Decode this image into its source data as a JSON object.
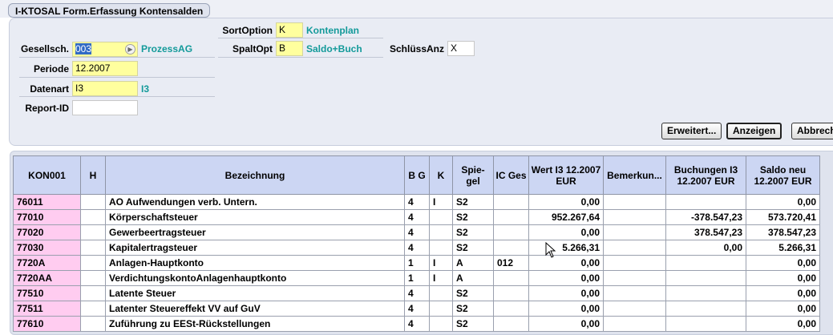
{
  "window": {
    "title": "I-KTOSAL Form.Erfassung Kontensalden"
  },
  "form": {
    "gesellsch": {
      "label": "Gesellsch.",
      "value": "003",
      "desc": "ProzessAG"
    },
    "periode": {
      "label": "Periode",
      "value": "12.2007"
    },
    "datenart": {
      "label": "Datenart",
      "value": "I3",
      "desc": "I3"
    },
    "report_id": {
      "label": "Report-ID",
      "value": ""
    },
    "sortoption": {
      "label": "SortOption",
      "value": "K",
      "desc": "Kontenplan"
    },
    "spaltopt": {
      "label": "SpaltOpt",
      "value": "B",
      "desc": "Saldo+Buch"
    },
    "schluessanz": {
      "label": "SchlüssAnz",
      "value": "X"
    }
  },
  "buttons": {
    "erweitert": "Erweitert...",
    "anzeigen": "Anzeigen",
    "abbrechen": "Abbrech"
  },
  "table": {
    "headers": {
      "kon": "KON001",
      "h": "H",
      "bezeichnung": "Bezeichnung",
      "bg": "B G",
      "k": "K",
      "spiegel": "Spie- gel",
      "icges": "IC Ges",
      "wert": "Wert I3 12.2007 EUR",
      "bemerkung": "Bemerkun...",
      "buchungen": "Buchungen I3 12.2007 EUR",
      "saldo": "Saldo neu 12.2007 EUR"
    },
    "rows": [
      {
        "kon": "76011",
        "h": "",
        "bez": "AO Aufwendungen verb. Untern.",
        "bg": "4",
        "k": "I",
        "sp": "S2",
        "ic": "",
        "wert": "0,00",
        "bem": "",
        "buch": "",
        "saldo": "0,00"
      },
      {
        "kon": "77010",
        "h": "",
        "bez": "Körperschaftsteuer",
        "bg": "4",
        "k": "",
        "sp": "S2",
        "ic": "",
        "wert": "952.267,64",
        "bem": "",
        "buch": "-378.547,23",
        "saldo": "573.720,41"
      },
      {
        "kon": "77020",
        "h": "",
        "bez": "Gewerbeertragsteuer",
        "bg": "4",
        "k": "",
        "sp": "S2",
        "ic": "",
        "wert": "0,00",
        "bem": "",
        "buch": "378.547,23",
        "saldo": "378.547,23"
      },
      {
        "kon": "77030",
        "h": "",
        "bez": "Kapitalertragsteuer",
        "bg": "4",
        "k": "",
        "sp": "S2",
        "ic": "",
        "wert": "5.266,31",
        "bem": "",
        "buch": "0,00",
        "saldo": "5.266,31"
      },
      {
        "kon": "7720A",
        "h": "",
        "bez": "Anlagen-Hauptkonto",
        "bg": "1",
        "k": "I",
        "sp": "A",
        "ic": "012",
        "wert": "0,00",
        "bem": "",
        "buch": "",
        "saldo": "0,00"
      },
      {
        "kon": "7720AA",
        "h": "",
        "bez": "VerdichtungskontoAnlagenhauptkonto",
        "bg": "1",
        "k": "I",
        "sp": "A",
        "ic": "",
        "wert": "0,00",
        "bem": "",
        "buch": "",
        "saldo": "0,00"
      },
      {
        "kon": "77510",
        "h": "",
        "bez": "Latente Steuer",
        "bg": "4",
        "k": "",
        "sp": "S2",
        "ic": "",
        "wert": "0,00",
        "bem": "",
        "buch": "",
        "saldo": "0,00"
      },
      {
        "kon": "77511",
        "h": "",
        "bez": "Latenter Steuereffekt VV auf GuV",
        "bg": "4",
        "k": "",
        "sp": "S2",
        "ic": "",
        "wert": "0,00",
        "bem": "",
        "buch": "",
        "saldo": "0,00"
      },
      {
        "kon": "77610",
        "h": "",
        "bez": "Zuführung zu EESt-Rückstellungen",
        "bg": "4",
        "k": "",
        "sp": "S2",
        "ic": "",
        "wert": "0,00",
        "bem": "",
        "buch": "",
        "saldo": "0,00"
      }
    ]
  },
  "colors": {
    "field_bg": "#ffff9e",
    "desc_text": "#139a9a",
    "header_bg": "#ccd6f3",
    "key_cell_bg": "#ffccf0"
  }
}
